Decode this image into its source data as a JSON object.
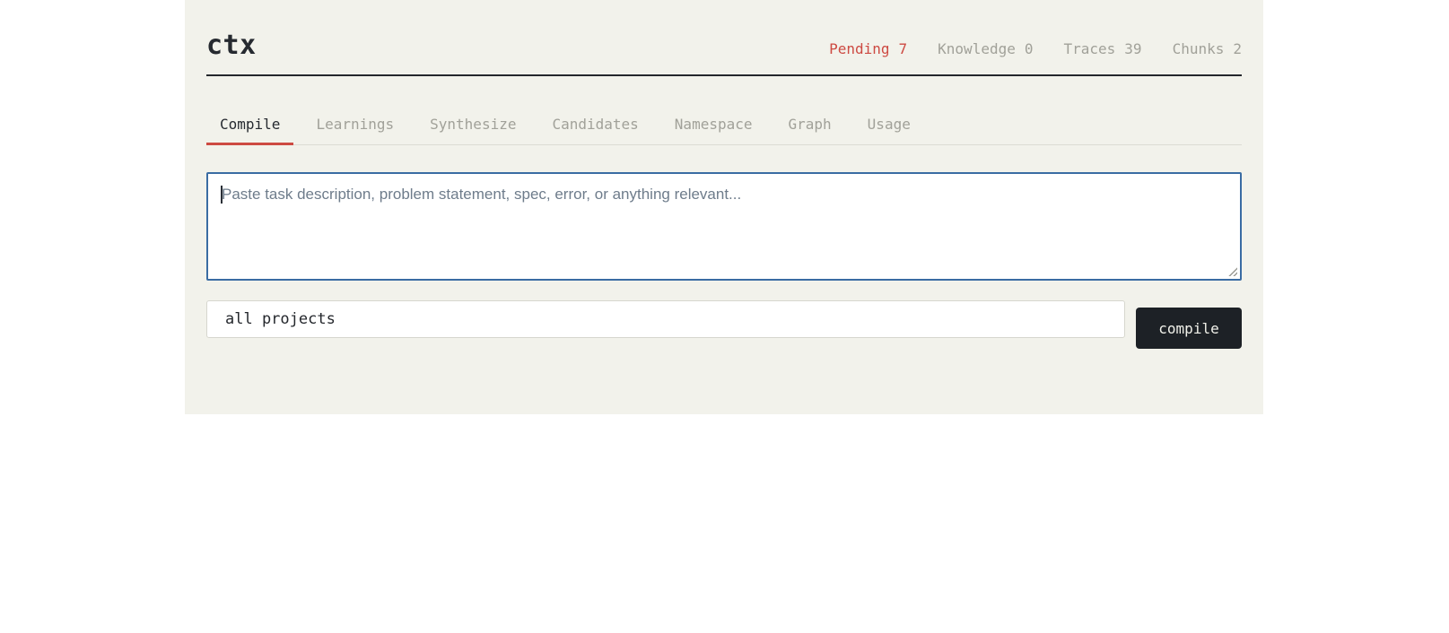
{
  "app": {
    "title": "ctx"
  },
  "header": {
    "stats": [
      {
        "label": "Pending",
        "value": "7"
      },
      {
        "label": "Knowledge",
        "value": "0"
      },
      {
        "label": "Traces",
        "value": "39"
      },
      {
        "label": "Chunks",
        "value": "2"
      }
    ]
  },
  "tabs": [
    {
      "label": "Compile",
      "active": true
    },
    {
      "label": "Learnings",
      "active": false
    },
    {
      "label": "Synthesize",
      "active": false
    },
    {
      "label": "Candidates",
      "active": false
    },
    {
      "label": "Namespace",
      "active": false
    },
    {
      "label": "Graph",
      "active": false
    },
    {
      "label": "Usage",
      "active": false
    }
  ],
  "compile_panel": {
    "textarea_placeholder": "Paste task description, problem statement, spec, error, or anything relevant...",
    "project_select": {
      "selected": "all projects"
    },
    "compile_button_label": "compile"
  },
  "colors": {
    "panel_background": "#f2f2eb",
    "accent_red": "#cd4a42",
    "focus_blue": "#3a6ca3",
    "button_background": "#1d2126",
    "text_dark": "#262a30",
    "text_muted": "#a1a199"
  }
}
